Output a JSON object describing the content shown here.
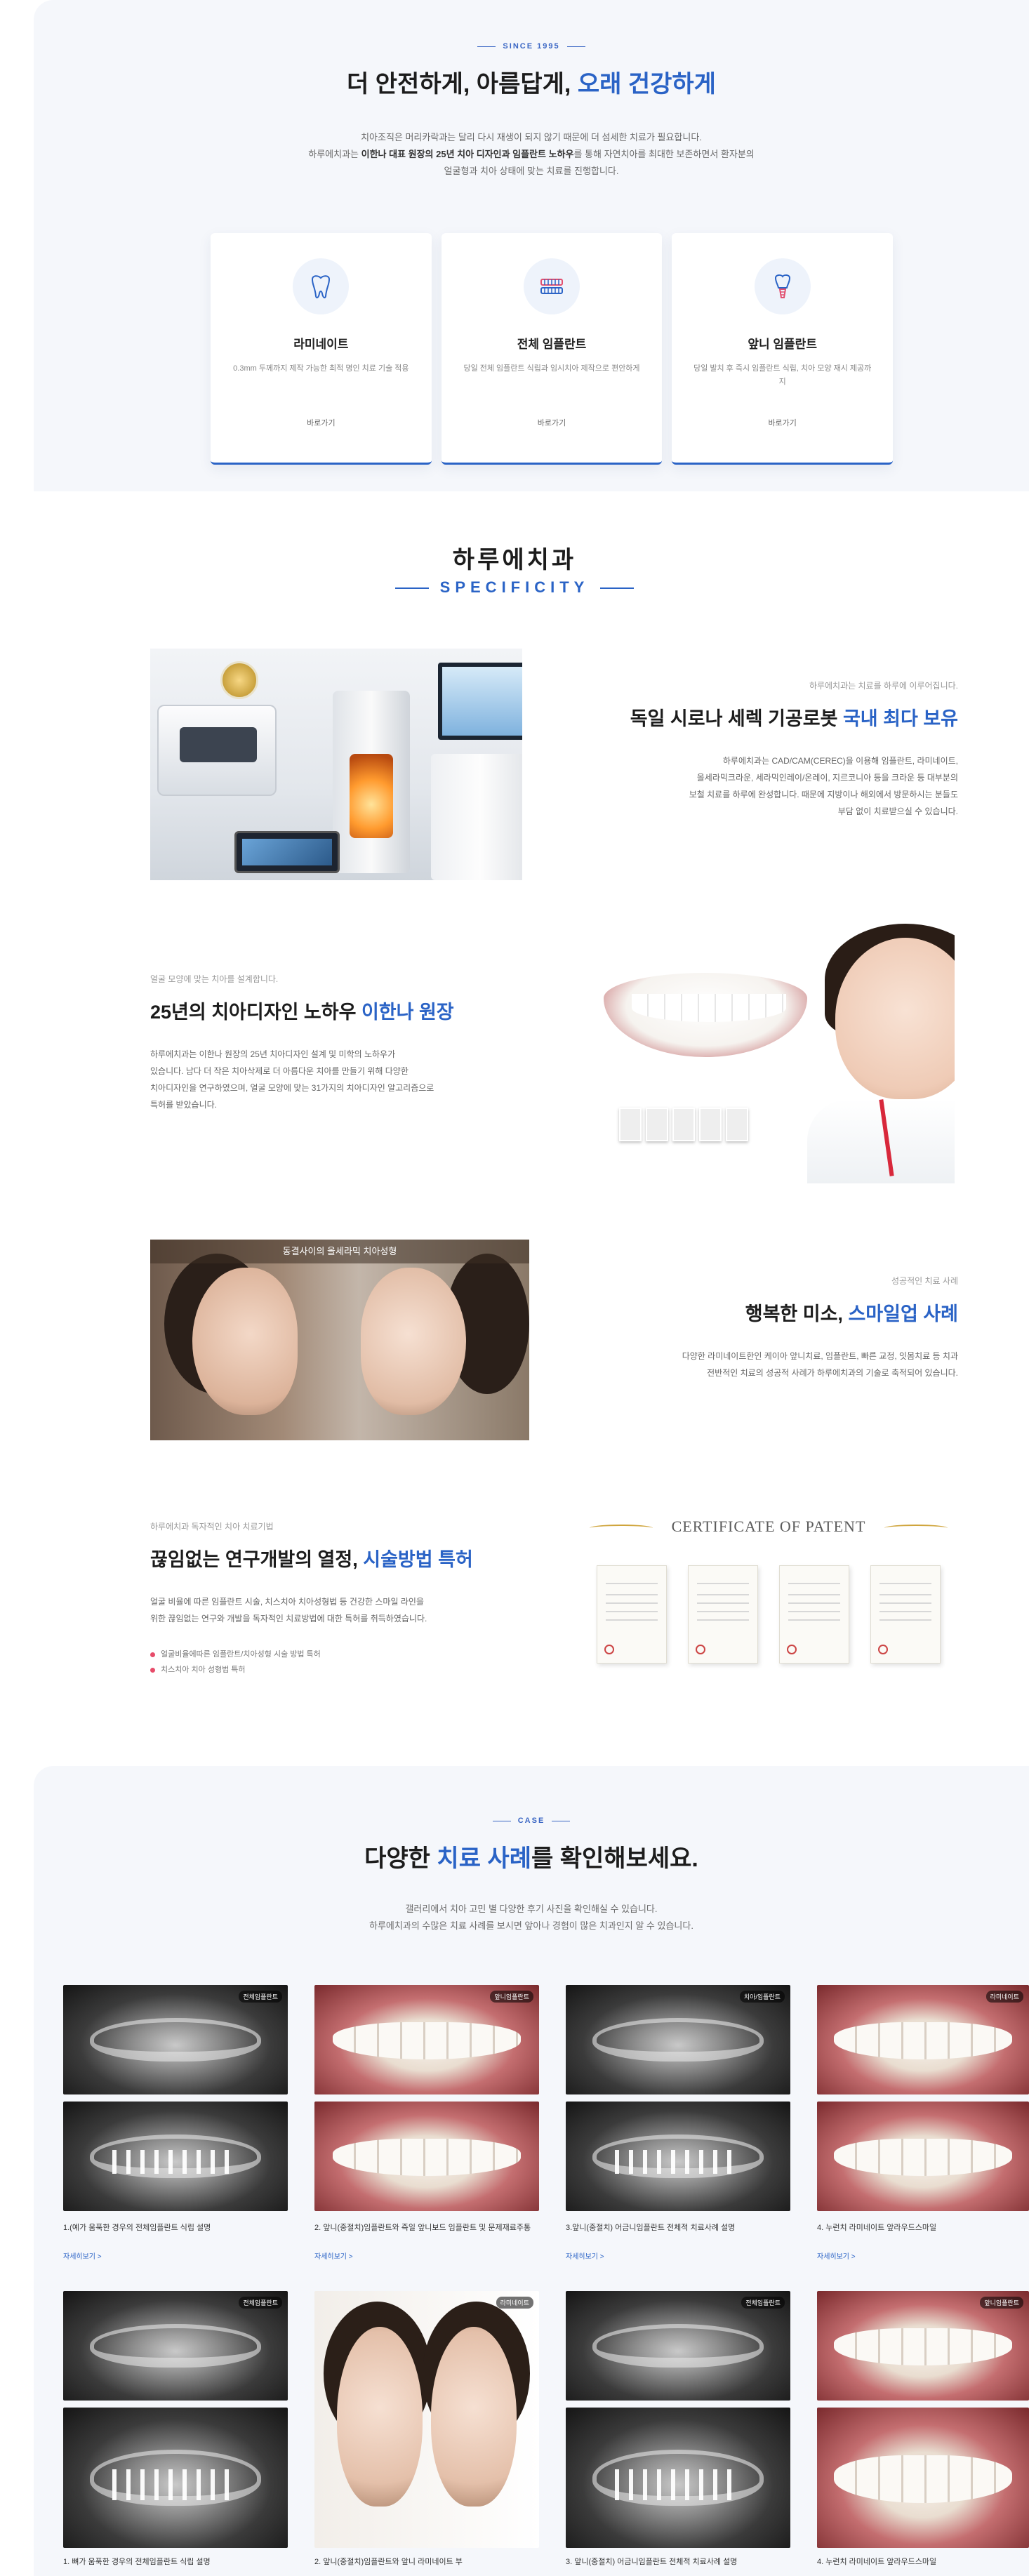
{
  "section1": {
    "eyebrow": "SINCE 1995",
    "title_part1": "더 안전하게, 아름답게, ",
    "title_highlight": "오래 건강하게",
    "intro_line1": "치아조직은 머리카락과는 달리 다시 재생이 되지 않기 때문에 더 섬세한 치료가 필요합니다.",
    "intro_line2_pre": "하루에치과는 ",
    "intro_line2_bold": "이한나 대표 원장의 25년 치아 디자인과 임플란트 노하우",
    "intro_line2_post": "를 통해 자연치아를 최대한 보존하면서 환자분의",
    "intro_line3": "얼굴형과 치아 상태에 맞는 치료를 진행합니다.",
    "cards": [
      {
        "icon": "tooth-veneer-icon",
        "title": "라미네이트",
        "desc": "0.3mm 두께까지 제작 가능한 최적 명인 치료 기술 적용",
        "more": "바로가기"
      },
      {
        "icon": "full-implant-icon",
        "title": "전체 임플란트",
        "desc": "당일 전체 임플란트 식립과 임시치아 제작으로 편안하게",
        "more": "바로가기"
      },
      {
        "icon": "front-tooth-implant-icon",
        "title": "앞니 임플란트",
        "desc": "당일 발치 후 즉시 임플란트 식립, 치아 모양 재시 제공까지",
        "more": "바로가기"
      }
    ]
  },
  "section2": {
    "title": "하루에치과",
    "subtitle": "SPECIFICITY",
    "features": [
      {
        "label": "하루에치과는 치료를 하루에 이루어집니다.",
        "title_pre": "독일 시로나 세렉 기공로봇 ",
        "title_highlight": "국내 최다 보유",
        "desc": [
          "하루에치과는 CAD/CAM(CEREC)을 이용해 임플란트, 라미네이트,",
          "올세라믹크라운, 세라믹인레이/온레이, 지르코니아 등을 크라운 등 대부분의",
          "보철 치료를 하루에 완성합니다. 때문에 지방이나 해외에서 방문하시는 분들도",
          "부담 없이 치료받으실 수 있습니다."
        ]
      },
      {
        "label": "얼굴 모양에 맞는 치아를 설계합니다.",
        "title_pre": "25년의 치아디자인 노하우 ",
        "title_highlight": "이한나 원장",
        "desc": [
          "하루에치과는 이한나 원장의 25년 치아디자인 설계 및 미학의 노하우가",
          "있습니다. 남다 더 작은 치아삭제로 더 아름다운 치아를 만들기 위해 다양한",
          "치아디자인을 연구하였으며, 얼굴 모양에 맞는 31가지의 치아디자인 알고리즘으로",
          "특허를 받았습니다."
        ]
      },
      {
        "caption": "동결사이의 올세라믹 치아성형",
        "label": "성공적인 치료 사례",
        "title_pre": "행복한 미소, ",
        "title_highlight": "스마일업 사례",
        "desc": [
          "다양한 라미네이트한인 케이아 앞니치료, 임플란트, 빠른 교정, 잇몸치료 등 치과",
          "전반적인 치료의 성공적 사례가 하루에치과의 기술로 축적되어 있습니다."
        ]
      },
      {
        "label": "하루에치과 독자적인 치아 치료기법",
        "title_pre": "끊임없는 연구개발의 열정, ",
        "title_highlight": "시술방법 특허",
        "desc": [
          "얼굴 비율에 따른 임플란트 시술, 치스치아 치아성형법 등 건강한 스마일 라인을",
          "위한 끊임없는 연구와 개발을 독자적인 치료방법에 대한 특허를 취득하였습니다."
        ],
        "bullets": [
          "얼굴비율에따른 임플란트/치아성형 시술 방법 특허",
          "치스치아 치아 성형법 특허"
        ],
        "certificate_title": "CERTIFICATE OF PATENT"
      }
    ]
  },
  "section3": {
    "eyebrow": "CASE",
    "title_pre": "다양한 ",
    "title_highlight": "치료 사례",
    "title_post": "를 확인해보세요.",
    "intro_line1": "갤러리에서 치아 고민 별 다양한 후기 사진을 확인해실 수 있습니다.",
    "intro_line2": "하루에치과의 수많은 치료 사례를 보시면 앞아나 경험이 많은 치과인지 알 수 있습니다.",
    "row1": [
      {
        "tag": "전체임플란트",
        "caption": "1.(예가 움푹한 경우의 전체임플란트 식립 설명",
        "link": "자세히보기 >"
      },
      {
        "tag": "앞니임플란트",
        "caption": "2. 앞니(중절치)임플란트와 즉일 앞니보드 임플란트 및 문제재료주통",
        "link": "자세히보기 >"
      },
      {
        "tag": "치아/임플란트",
        "caption": "3.앞니(중절치) 어금니임플란트 전체적 치료사례 설명",
        "link": "자세히보기 >"
      },
      {
        "tag": "라미네이트",
        "caption": "4. 누런치 라미네이트 앞라우드스마일",
        "link": "자세히보기 >"
      }
    ],
    "row2": [
      {
        "tag": "전체임플란트"
      },
      {
        "tag": "라미네이트"
      },
      {
        "tag": "전체임플란트"
      },
      {
        "tag": "앞니임플란트"
      }
    ],
    "row2_captions": [
      "1. 뼈가 움푹한 경우의 전체임플란트 식립 설명",
      "2. 앞니(중절치)임플란트와 앞니 라미네이트 부",
      "3. 앞니(중절치) 어금니임플란트 전체적 치료사례 설명",
      "4. 누런치 라미네이트 앞라우드스마일"
    ]
  }
}
